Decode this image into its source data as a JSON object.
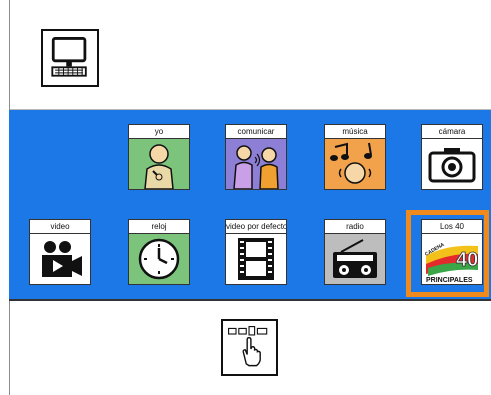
{
  "header": {
    "home_icon": "computer-icon"
  },
  "tiles": [
    {
      "label": "yo",
      "icon": "person-self-icon",
      "bg": "#7cc47c"
    },
    {
      "label": "comunicar",
      "icon": "people-talking-icon",
      "bg": "#8e7fd6"
    },
    {
      "label": "música",
      "icon": "music-icon",
      "bg": "#f2a24a"
    },
    {
      "label": "cámara",
      "icon": "camera-icon",
      "bg": "#ffffff"
    },
    {
      "label": "video",
      "icon": "video-camera-icon",
      "bg": "#ffffff"
    },
    {
      "label": "reloj",
      "icon": "clock-icon",
      "bg": "#7cc47c"
    },
    {
      "label": "video por defecto",
      "icon": "film-icon",
      "bg": "#ffffff"
    },
    {
      "label": "radio",
      "icon": "radio-icon",
      "bg": "#bdbdbd"
    },
    {
      "label": "Los 40",
      "icon": "los40-logo",
      "bg": "#ffffff"
    }
  ],
  "logo": {
    "brand_top": "CADENA",
    "brand_bottom": "PRINCIPALES",
    "brand_number": "40"
  },
  "footer": {
    "grid_icon": "grid-select-hand-icon"
  },
  "colors": {
    "band": "#1b78e6",
    "selection": "#f08a1c"
  }
}
